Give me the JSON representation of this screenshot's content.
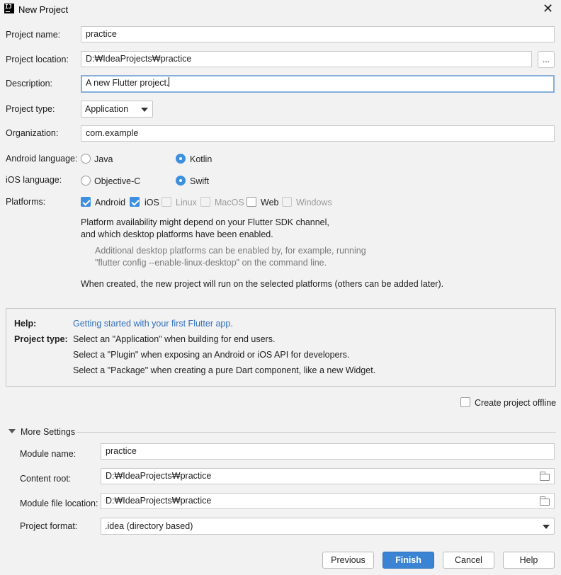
{
  "window": {
    "title": "New Project",
    "app_icon_text": "IJ"
  },
  "form": {
    "project_name": {
      "label": "Project name:",
      "value": "practice"
    },
    "project_location": {
      "label": "Project location:",
      "value": "D:₩IdeaProjects₩practice",
      "browse_label": "..."
    },
    "description": {
      "label": "Description:",
      "value": "A new Flutter project."
    },
    "project_type": {
      "label": "Project type:",
      "value": "Application"
    },
    "organization": {
      "label": "Organization:",
      "value": "com.example"
    },
    "android_language": {
      "label": "Android language:",
      "options": [
        {
          "label": "Java",
          "checked": false
        },
        {
          "label": "Kotlin",
          "checked": true
        }
      ]
    },
    "ios_language": {
      "label": "iOS language:",
      "options": [
        {
          "label": "Objective-C",
          "checked": false
        },
        {
          "label": "Swift",
          "checked": true
        }
      ]
    },
    "platforms": {
      "label": "Platforms:",
      "items": [
        {
          "label": "Android",
          "checked": true,
          "enabled": true
        },
        {
          "label": "iOS",
          "checked": true,
          "enabled": true
        },
        {
          "label": "Linux",
          "checked": false,
          "enabled": false
        },
        {
          "label": "MacOS",
          "checked": false,
          "enabled": false
        },
        {
          "label": "Web",
          "checked": false,
          "enabled": true
        },
        {
          "label": "Windows",
          "checked": false,
          "enabled": false
        }
      ]
    },
    "notes": {
      "availability_1": "Platform availability might depend on your Flutter SDK channel,",
      "availability_2": "and which desktop platforms have been enabled.",
      "desktop_1": "Additional desktop platforms can be enabled by, for example, running",
      "desktop_2": "\"flutter config --enable-linux-desktop\" on the command line.",
      "created": "When created, the new project will run on the selected platforms (others can be added later)."
    }
  },
  "help": {
    "help_label": "Help:",
    "help_link": "Getting started with your first Flutter app.",
    "type_label": "Project type:",
    "lines": [
      "Select an \"Application\" when building for end users.",
      "Select a \"Plugin\" when exposing an Android or iOS API for developers.",
      "Select a \"Package\" when creating a pure Dart component, like a new Widget."
    ]
  },
  "offline": {
    "label": "Create project offline",
    "checked": false
  },
  "more_settings": {
    "title": "More Settings",
    "expanded": true,
    "module_name": {
      "label": "Module name:",
      "value": "practice"
    },
    "content_root": {
      "label": "Content root:",
      "value": "D:₩IdeaProjects₩practice"
    },
    "module_file_location": {
      "label": "Module file location:",
      "value": "D:₩IdeaProjects₩practice"
    },
    "project_format": {
      "label": "Project format:",
      "value": ".idea (directory based)"
    }
  },
  "buttons": {
    "previous": "Previous",
    "finish": "Finish",
    "cancel": "Cancel",
    "help": "Help"
  },
  "icons": {
    "close": "close-icon",
    "folder": "folder-icon",
    "dropdown": "chevron-down-icon",
    "collapse": "triangle-down-icon"
  },
  "colors": {
    "accent": "#3d8fe0",
    "primary_button": "#3b84d3",
    "link": "#2e6fbd",
    "focus_border": "#87afda",
    "background": "#f2f2f2"
  }
}
